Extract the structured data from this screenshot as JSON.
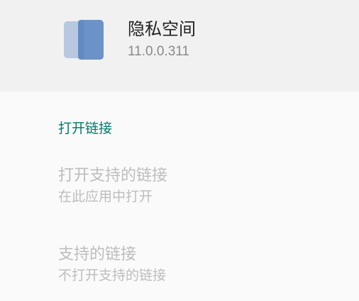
{
  "app": {
    "name": "隐私空间",
    "version": "11.0.0.311",
    "icon": "privacy-space-app-icon"
  },
  "section": {
    "title": "打开链接"
  },
  "options": [
    {
      "title": "打开支持的链接",
      "subtitle": "在此应用中打开"
    },
    {
      "title": "支持的链接",
      "subtitle": "不打开支持的链接"
    }
  ],
  "colors": {
    "header_bg": "#f1f1f1",
    "accent": "#00796b",
    "disabled_text": "#bdbdbd",
    "icon_back": "#b3c5dd",
    "icon_front": "#6b93c7"
  }
}
